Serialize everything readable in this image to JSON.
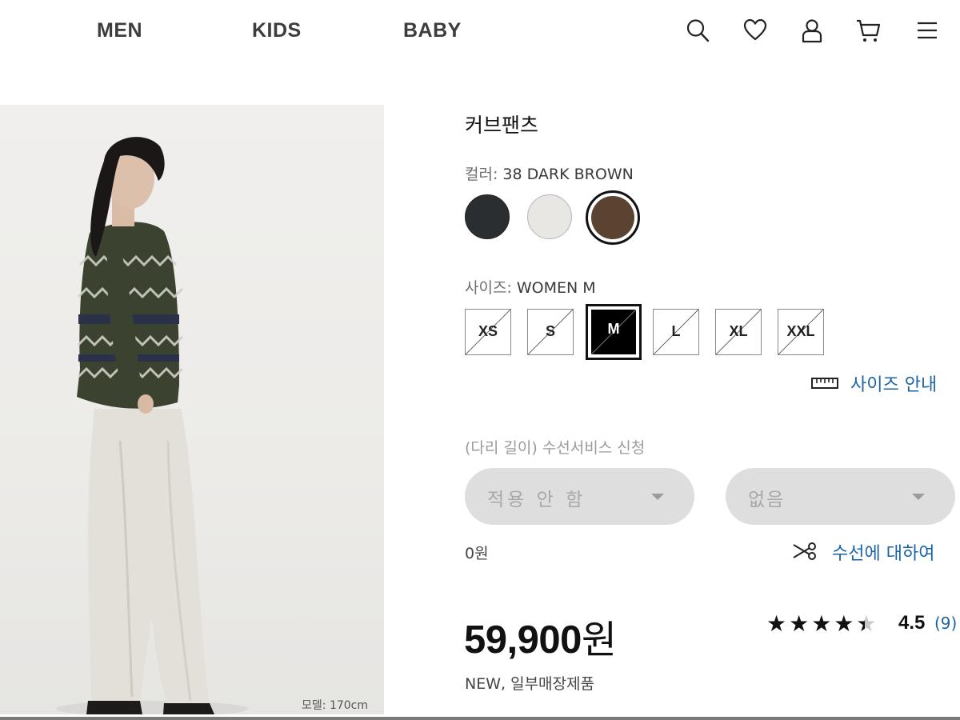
{
  "nav": {
    "links": [
      "MEN",
      "KIDS",
      "BABY"
    ],
    "icons": [
      "search-icon",
      "heart-icon",
      "user-icon",
      "cart-icon",
      "menu-icon"
    ]
  },
  "image": {
    "caption": "모델: 170cm"
  },
  "product": {
    "name": "커브팬츠",
    "color_label": "컬러:",
    "color_value": "38 DARK BROWN",
    "colors": [
      {
        "name": "black",
        "hex": "#2b2e30"
      },
      {
        "name": "off-white",
        "hex": "#e9e7e3"
      },
      {
        "name": "dark-brown",
        "hex": "#5a4330",
        "selected": true
      }
    ],
    "size_label": "사이즈:",
    "size_value": "WOMEN M",
    "sizes": [
      {
        "label": "XS",
        "available": false
      },
      {
        "label": "S",
        "available": false
      },
      {
        "label": "M",
        "available": false,
        "selected": true
      },
      {
        "label": "L",
        "available": false
      },
      {
        "label": "XL",
        "available": false
      },
      {
        "label": "XXL",
        "available": false
      }
    ],
    "size_guide": "사이즈 안내",
    "alteration_label": "(다리 길이) 수선서비스 신청",
    "alteration_option": "적용 안 함",
    "alteration_length": "없음",
    "alteration_fee": "0원",
    "alteration_info": "수선에 대하여",
    "price": "59,900",
    "currency": "원",
    "stars": "★★★★",
    "rating": "4.5",
    "reviews": "(9)",
    "tags": "NEW,  일부매장제품"
  },
  "colors": {
    "link": "#1b63a8",
    "dropdown_bg": "#dedede"
  }
}
